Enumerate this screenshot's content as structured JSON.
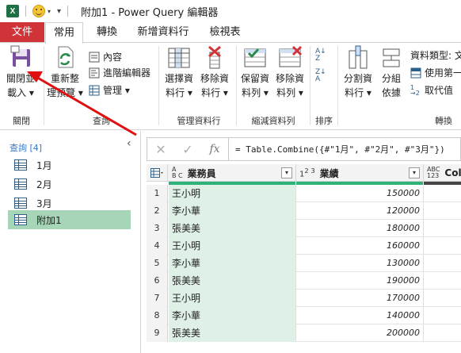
{
  "titlebar": {
    "app_icon": "X",
    "title": "附加1 - Power Query 編輯器"
  },
  "tabs": [
    {
      "label": "文件"
    },
    {
      "label": "常用"
    },
    {
      "label": "轉換"
    },
    {
      "label": "新增資料行"
    },
    {
      "label": "檢視表"
    }
  ],
  "ribbon": {
    "close_load": {
      "line1": "關閉並",
      "line2": "載入 ▾"
    },
    "refresh": {
      "line1": "重新整",
      "line2": "理預覽 ▾"
    },
    "properties": "內容",
    "advanced_editor": "進階編輯器",
    "manage": "管理 ▾",
    "choose_cols": {
      "line1": "選擇資",
      "line2": "料行 ▾"
    },
    "remove_cols": {
      "line1": "移除資",
      "line2": "料行 ▾"
    },
    "keep_rows": {
      "line1": "保留資",
      "line2": "料列 ▾"
    },
    "remove_rows": {
      "line1": "移除資",
      "line2": "料列 ▾"
    },
    "split_col": {
      "line1": "分割資",
      "line2": "料行 ▾"
    },
    "group_by": {
      "line1": "分組",
      "line2": "依據"
    },
    "data_type": "資料類型: 文",
    "use_first_row": "使用第一",
    "replace_values": "取代值",
    "groups": {
      "close": "關閉",
      "query": "查詢",
      "manage_cols": "管理資料行",
      "reduce_rows": "縮減資料列",
      "sort": "排序",
      "transform": "轉換"
    }
  },
  "queries_pane": {
    "header": "查詢 [4]",
    "items": [
      {
        "label": "1月",
        "selected": false
      },
      {
        "label": "2月",
        "selected": false
      },
      {
        "label": "3月",
        "selected": false
      },
      {
        "label": "附加1",
        "selected": true
      }
    ]
  },
  "formula_bar": {
    "cancel_symbol": "✕",
    "commit_symbol": "✓",
    "fx": "fx",
    "formula": "= Table.Combine({#\"1月\", #\"2月\", #\"3月\"})"
  },
  "grid": {
    "columns": [
      {
        "type_top": "A",
        "type_bottom": "B C",
        "type_label": "ABC",
        "name": "業務員"
      },
      {
        "type_top": "1",
        "type_bottom": "2 3",
        "type_label": "123",
        "name": "業績"
      },
      {
        "type_top": "ABC",
        "type_bottom": "123",
        "name": "Colum"
      }
    ],
    "rows": [
      {
        "num": "1",
        "name": "王小明",
        "value": "150000"
      },
      {
        "num": "2",
        "name": "李小華",
        "value": "120000"
      },
      {
        "num": "3",
        "name": "張美美",
        "value": "180000"
      },
      {
        "num": "4",
        "name": "王小明",
        "value": "160000"
      },
      {
        "num": "5",
        "name": "李小華",
        "value": "130000"
      },
      {
        "num": "6",
        "name": "張美美",
        "value": "190000"
      },
      {
        "num": "7",
        "name": "王小明",
        "value": "170000"
      },
      {
        "num": "8",
        "name": "李小華",
        "value": "140000"
      },
      {
        "num": "9",
        "name": "張美美",
        "value": "200000"
      }
    ]
  },
  "colors": {
    "file_tab": "#d13438",
    "accent_green": "#2db37a",
    "selected_query": "#a7d5b7",
    "annotation_arrow": "#e01010"
  }
}
